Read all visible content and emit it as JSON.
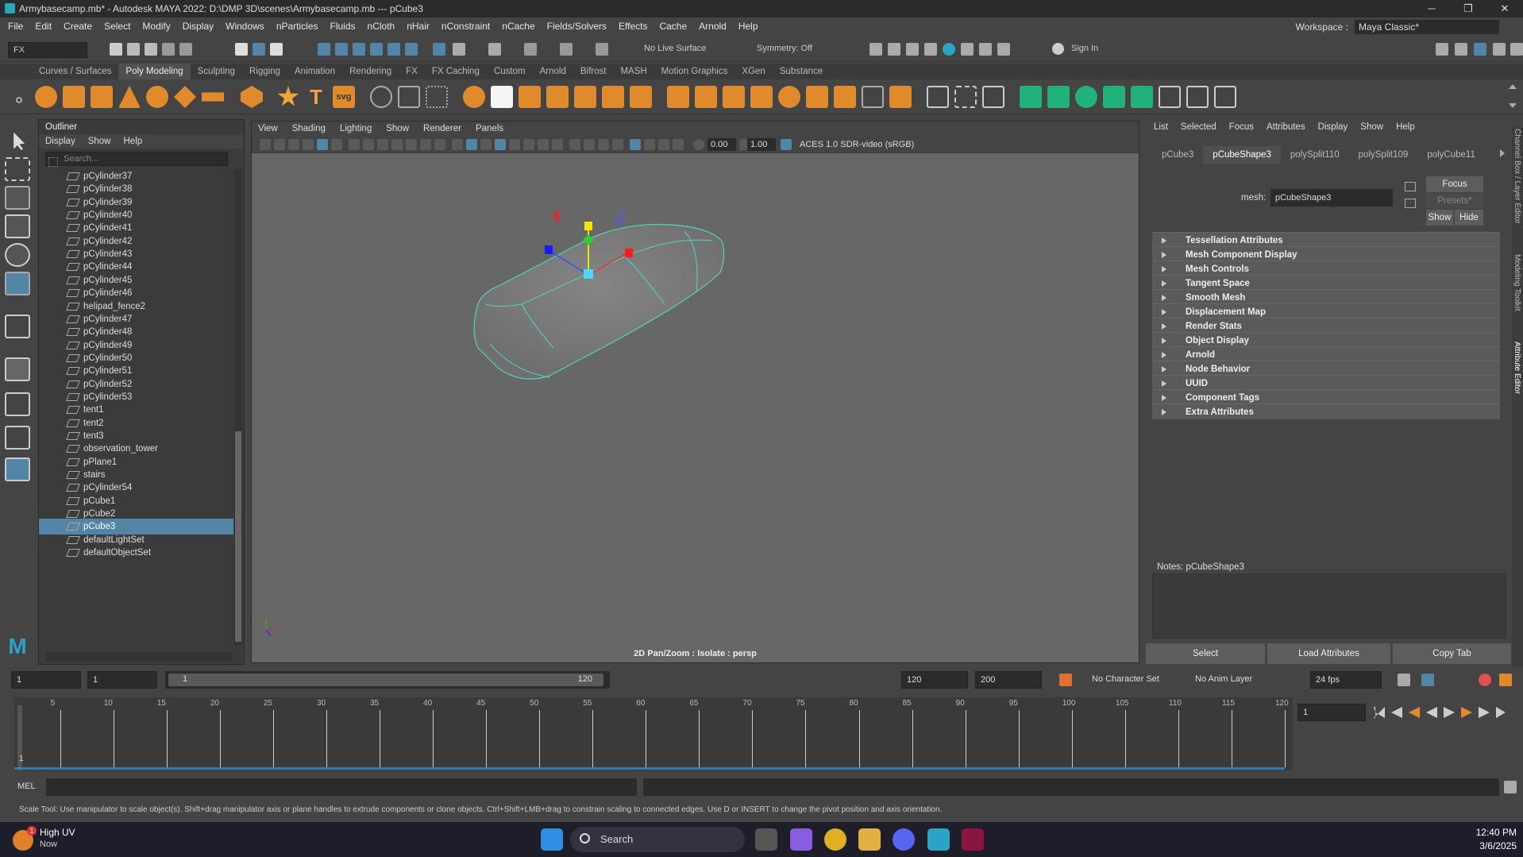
{
  "window": {
    "title": "Armybasecamp.mb* - Autodesk MAYA 2022: D:\\DMP 3D\\scenes\\Armybasecamp.mb  ---  pCube3"
  },
  "menu": [
    "File",
    "Edit",
    "Create",
    "Select",
    "Modify",
    "Display",
    "Windows",
    "nParticles",
    "Fluids",
    "nCloth",
    "nHair",
    "nConstraint",
    "nCache",
    "Fields/Solvers",
    "Effects",
    "Cache",
    "Arnold",
    "Help"
  ],
  "workspace": {
    "label": "Workspace :",
    "value": "Maya Classic*"
  },
  "statusline": {
    "menuset": "FX",
    "live_surface": "No Live Surface",
    "symmetry": "Symmetry: Off",
    "signin": "Sign In"
  },
  "shelf_tabs": [
    "Curves / Surfaces",
    "Poly Modeling",
    "Sculpting",
    "Rigging",
    "Animation",
    "Rendering",
    "FX",
    "FX Caching",
    "Custom",
    "Arnold",
    "Bifrost",
    "MASH",
    "Motion Graphics",
    "XGen",
    "Substance"
  ],
  "shelf_active": "Poly Modeling",
  "shelf_text": {
    "t_icon": "T",
    "svg_icon": "svg"
  },
  "outliner": {
    "title": "Outliner",
    "menu": [
      "Display",
      "Show",
      "Help"
    ],
    "search_placeholder": "Search...",
    "items": [
      "pCylinder37",
      "pCylinder38",
      "pCylinder39",
      "pCylinder40",
      "pCylinder41",
      "pCylinder42",
      "pCylinder43",
      "pCylinder44",
      "pCylinder45",
      "pCylinder46",
      "helipad_fence2",
      "pCylinder47",
      "pCylinder48",
      "pCylinder49",
      "pCylinder50",
      "pCylinder51",
      "pCylinder52",
      "pCylinder53",
      "tent1",
      "tent2",
      "tent3",
      "observation_tower",
      "pPlane1",
      "stairs",
      "pCylinder54",
      "pCube1",
      "pCube2",
      "pCube3",
      "defaultLightSet",
      "defaultObjectSet"
    ],
    "selected": "pCube3"
  },
  "viewport": {
    "menu": [
      "View",
      "Shading",
      "Lighting",
      "Show",
      "Renderer",
      "Panels"
    ],
    "exposure": "0.00",
    "gamma": "1.00",
    "colorspace": "ACES 1.0 SDR-video (sRGB)",
    "label": "2D Pan/Zoom : Isolate : persp"
  },
  "attribute_editor": {
    "menu": [
      "List",
      "Selected",
      "Focus",
      "Attributes",
      "Display",
      "Show",
      "Help"
    ],
    "tabs": [
      "pCube3",
      "pCubeShape3",
      "polySplit110",
      "polySplit109",
      "polyCube11"
    ],
    "active_tab": "pCubeShape3",
    "mesh_label": "mesh:",
    "mesh_value": "pCubeShape3",
    "focus": "Focus",
    "presets": "Presets*",
    "show": "Show",
    "hide": "Hide",
    "sections": [
      "Tessellation Attributes",
      "Mesh Component Display",
      "Mesh Controls",
      "Tangent Space",
      "Smooth Mesh",
      "Displacement Map",
      "Render Stats",
      "Object Display",
      "Arnold",
      "Node Behavior",
      "UUID",
      "Component Tags",
      "Extra Attributes"
    ],
    "notes": "Notes:  pCubeShape3",
    "buttons": [
      "Select",
      "Load Attributes",
      "Copy Tab"
    ]
  },
  "range": {
    "start": "1",
    "playstart": "1",
    "slider_start": "1",
    "slider_end": "120",
    "playend": "120",
    "end": "200",
    "character": "No Character Set",
    "anim_layer": "No Anim Layer",
    "fps": "24 fps"
  },
  "timeline": {
    "labels": [
      "5",
      "10",
      "15",
      "20",
      "25",
      "30",
      "35",
      "40",
      "45",
      "50",
      "55",
      "60",
      "65",
      "70",
      "75",
      "80",
      "85",
      "90",
      "95",
      "100",
      "105",
      "110",
      "115",
      "120"
    ],
    "current": "1",
    "frame_field": "1"
  },
  "mel": {
    "label": "MEL"
  },
  "helpline": "Scale Tool: Use manipulator to scale object(s). Shift+drag manipulator axis or plane handles to extrude components or clone objects. Ctrl+Shift+LMB+drag to constrain scaling to connected edges. Use D or INSERT to change the pivot position and axis orientation.",
  "side_tabs": [
    "Channel Box / Layer Editor",
    "Modeling Toolkit",
    "Attribute Editor"
  ],
  "taskbar": {
    "weather_title": "High UV",
    "weather_sub": "Now",
    "weather_badge": "1",
    "search": "Search",
    "time": "12:40 PM",
    "date": "3/6/2025"
  },
  "colors": {
    "accent": "#5285a6",
    "selection": "#4fd6c4"
  }
}
